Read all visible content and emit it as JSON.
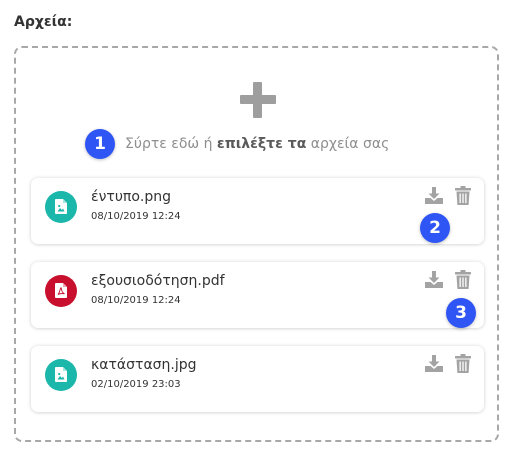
{
  "section": {
    "title": "Αρχεία:"
  },
  "dropzone": {
    "text_before": "Σύρτε εδώ ή",
    "link_text": "επιλέξτε τα",
    "text_after": "αρχεία σας",
    "add_icon": "plus-icon"
  },
  "badges": [
    "1",
    "2",
    "3"
  ],
  "files": [
    {
      "name": "έντυπο.png",
      "date": "08/10/2019 12:24",
      "type": "image",
      "icon_color": "#1bb7aa"
    },
    {
      "name": "εξουσιοδότηση.pdf",
      "date": "08/10/2019 12:24",
      "type": "pdf",
      "icon_color": "#c8102e"
    },
    {
      "name": "κατάσταση.jpg",
      "date": "02/10/2019 23:03",
      "type": "image",
      "icon_color": "#1bb7aa"
    }
  ],
  "actions": {
    "download_icon": "download-icon",
    "delete_icon": "trash-icon",
    "icon_color": "#a3a3a3"
  },
  "colors": {
    "accent": "#2f55f4",
    "border": "#a8a8a8"
  }
}
